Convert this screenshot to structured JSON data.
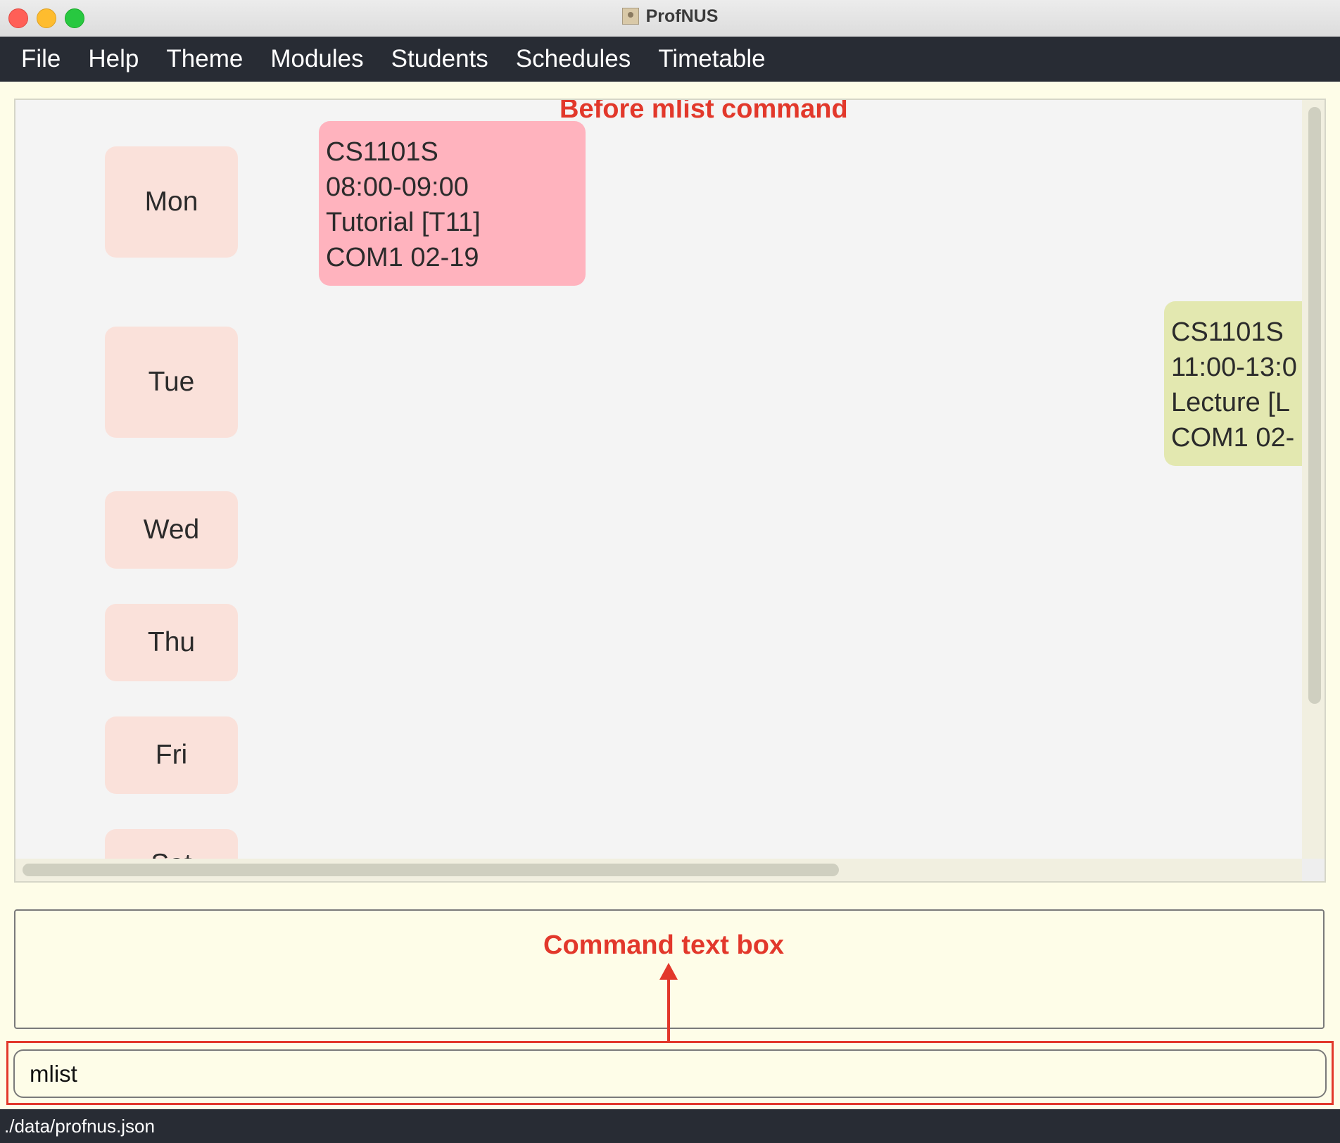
{
  "window": {
    "title": "ProfNUS"
  },
  "menu": {
    "items": [
      "File",
      "Help",
      "Theme",
      "Modules",
      "Students",
      "Schedules",
      "Timetable"
    ]
  },
  "timetable": {
    "annotation": "Before mlist command",
    "days": [
      "Mon",
      "Tue",
      "Wed",
      "Thu",
      "Fri",
      "Sat"
    ],
    "slots": [
      {
        "lines": [
          "CS1101S",
          "08:00-09:00",
          "Tutorial  [T11]",
          "COM1 02-19"
        ],
        "color": "#ffb3be"
      },
      {
        "lines": [
          "CS1101S",
          "11:00-13:0",
          "Lecture  [L",
          "COM1 02-"
        ],
        "color": "#e3e8b0"
      }
    ]
  },
  "result": {
    "annotation": "Command text box",
    "text": ""
  },
  "command": {
    "value": "mlist"
  },
  "status": {
    "path": "./data/profnus.json"
  },
  "colors": {
    "menubar": "#282c34",
    "background": "#fefde8",
    "annotation": "#e2382b",
    "day_card": "#fae1da"
  }
}
